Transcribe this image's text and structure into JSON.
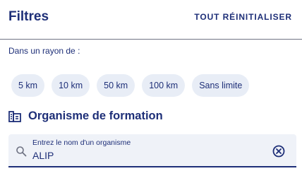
{
  "header": {
    "title": "Filtres",
    "reset_label": "TOUT RÉINITIALISER"
  },
  "radius": {
    "label": "Dans un rayon de :",
    "options": [
      "5 km",
      "10 km",
      "50 km",
      "100 km",
      "Sans limite"
    ]
  },
  "organisme": {
    "title": "Organisme de formation",
    "icon": "building-list-icon",
    "search": {
      "label": "Entrez le nom d'un organisme",
      "value": "ALIP",
      "search_icon": "search-icon",
      "clear_icon": "clear-circle-icon"
    }
  },
  "colors": {
    "primary": "#1e2f78",
    "chip_bg": "#e8edf6",
    "field_bg": "#eff2f8",
    "divider": "#6f7383"
  }
}
